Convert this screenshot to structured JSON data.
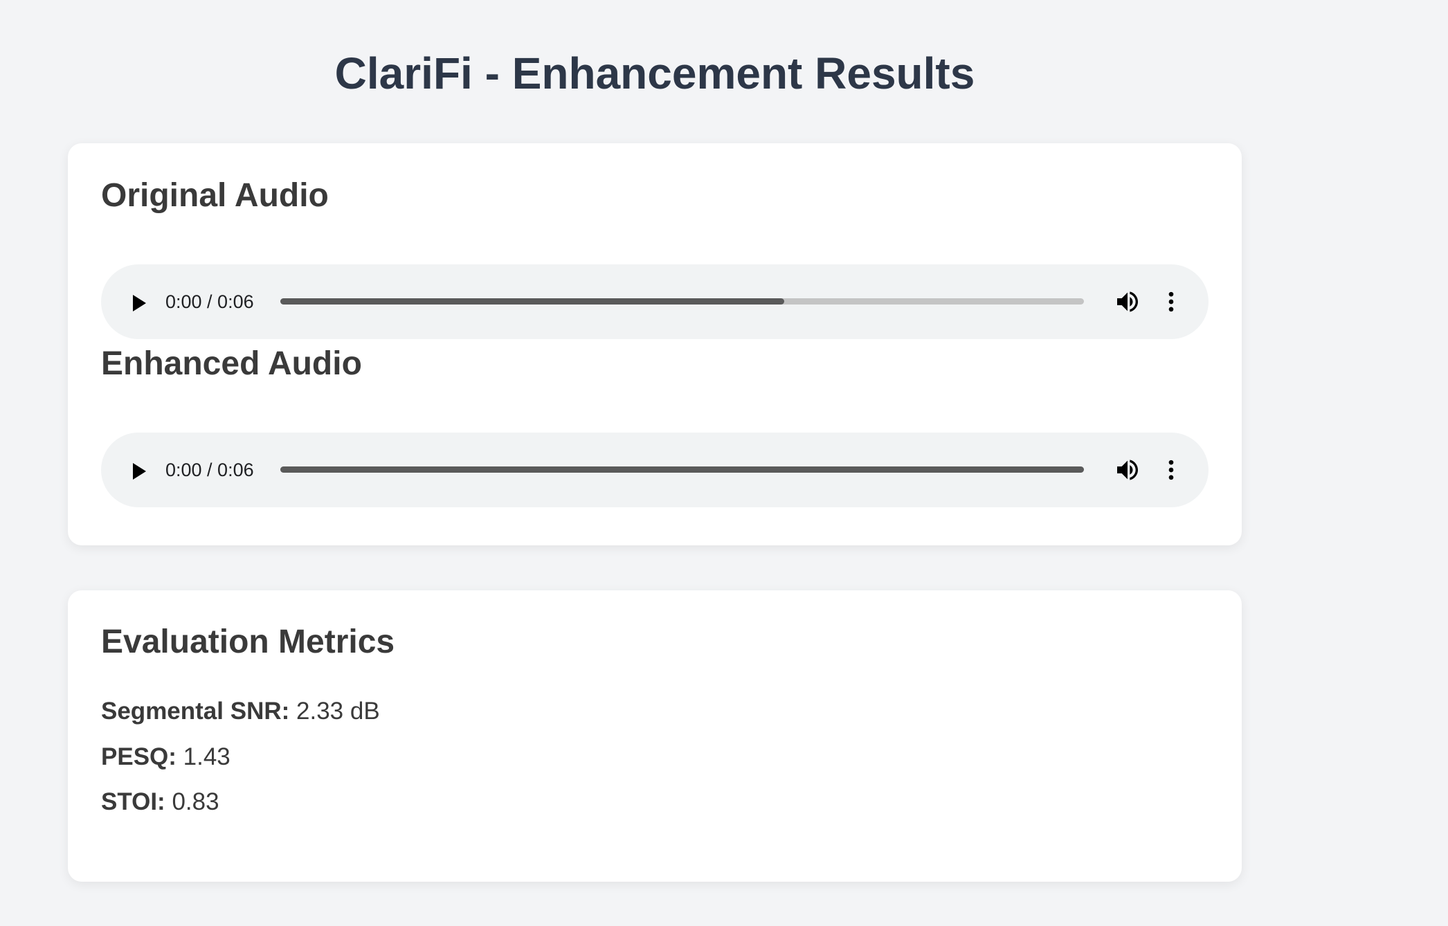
{
  "page": {
    "title": "ClariFi - Enhancement Results"
  },
  "audio_card": {
    "original": {
      "heading": "Original Audio",
      "time": "0:00 / 0:06",
      "seek_progress": 0.627,
      "play_icon": "play-icon",
      "volume_icon": "volume-icon",
      "menu_icon": "more-vert-icon"
    },
    "enhanced": {
      "heading": "Enhanced Audio",
      "time": "0:00 / 0:06",
      "seek_progress": 1.0,
      "play_icon": "play-icon",
      "volume_icon": "volume-icon",
      "menu_icon": "more-vert-icon"
    }
  },
  "metrics_card": {
    "heading": "Evaluation Metrics",
    "items": [
      {
        "label": "Segmental SNR:",
        "value": "2.33 dB"
      },
      {
        "label": "PESQ:",
        "value": "1.43"
      },
      {
        "label": "STOI:",
        "value": "0.83"
      }
    ]
  },
  "colors": {
    "background": "#f3f4f6",
    "card": "#ffffff",
    "title_text": "#2d3748",
    "heading_text": "#3a3a3a",
    "player_bg": "#f1f3f4",
    "seek_track": "#c4c4c4",
    "seek_fill": "#5a5a5a"
  }
}
